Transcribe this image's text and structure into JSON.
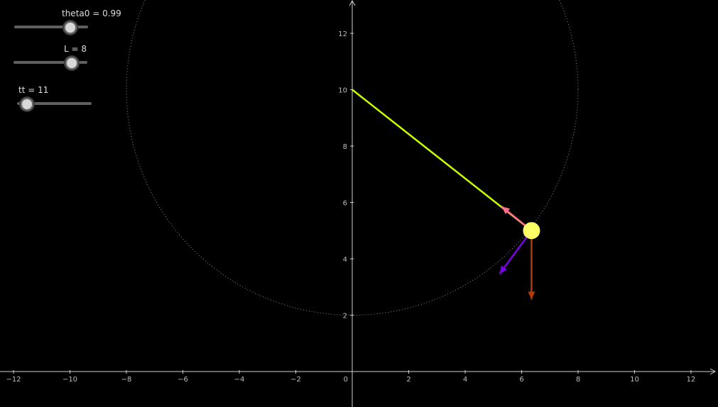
{
  "sliders": [
    {
      "label": "theta0 = 0.99",
      "value": 0.99
    },
    {
      "label": "L = 8",
      "value": 8
    },
    {
      "label": "tt = 11",
      "value": 11
    }
  ],
  "axes": {
    "x_ticks": [
      "−12",
      "−10",
      "−8",
      "−6",
      "−4",
      "−2",
      "2",
      "4",
      "6",
      "8",
      "10",
      "12"
    ],
    "y_ticks": [
      "2",
      "4",
      "6",
      "8",
      "10",
      "12"
    ],
    "origin_label": "0"
  },
  "pendulum": {
    "pivot": [
      0,
      10
    ],
    "bob": [
      6.35,
      5.0
    ],
    "length": 8
  },
  "colors": {
    "background": "#000000",
    "axis": "#cfcfcf",
    "rod": "#c8ff00",
    "bob": "#ffff66",
    "tension_vector": "#ff6e8a",
    "weight_vector": "#b33a00",
    "net_vector": "#7a00e6",
    "circle": "#8a8a8a"
  }
}
